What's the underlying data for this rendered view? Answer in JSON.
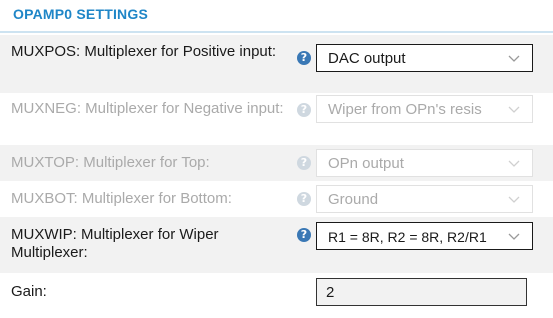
{
  "section": {
    "title": "OPAMP0 SETTINGS"
  },
  "rows": [
    {
      "label": "MUXPOS: Multiplexer for Positive input:",
      "value": "DAC output"
    },
    {
      "label": "MUXNEG: Multiplexer for Negative input:",
      "value": "Wiper from OPn's resis"
    },
    {
      "label": "MUXTOP: Multiplexer for Top:",
      "value": "OPn output"
    },
    {
      "label": "MUXBOT: Multiplexer for Bottom:",
      "value": "Ground"
    },
    {
      "label": "MUXWIP: Multiplexer for Wiper Multiplexer:",
      "value": "R1 = 8R, R2 = 8R, R2/R1"
    },
    {
      "label": "Gain:",
      "value": "2"
    }
  ],
  "icons": {
    "help": "question-mark-help-icon",
    "dropdown": "chevron-down-icon"
  },
  "colors": {
    "accent": "#1f86c7",
    "help_icon": "#3a78b5",
    "disabled_text": "#aaaaaa"
  }
}
